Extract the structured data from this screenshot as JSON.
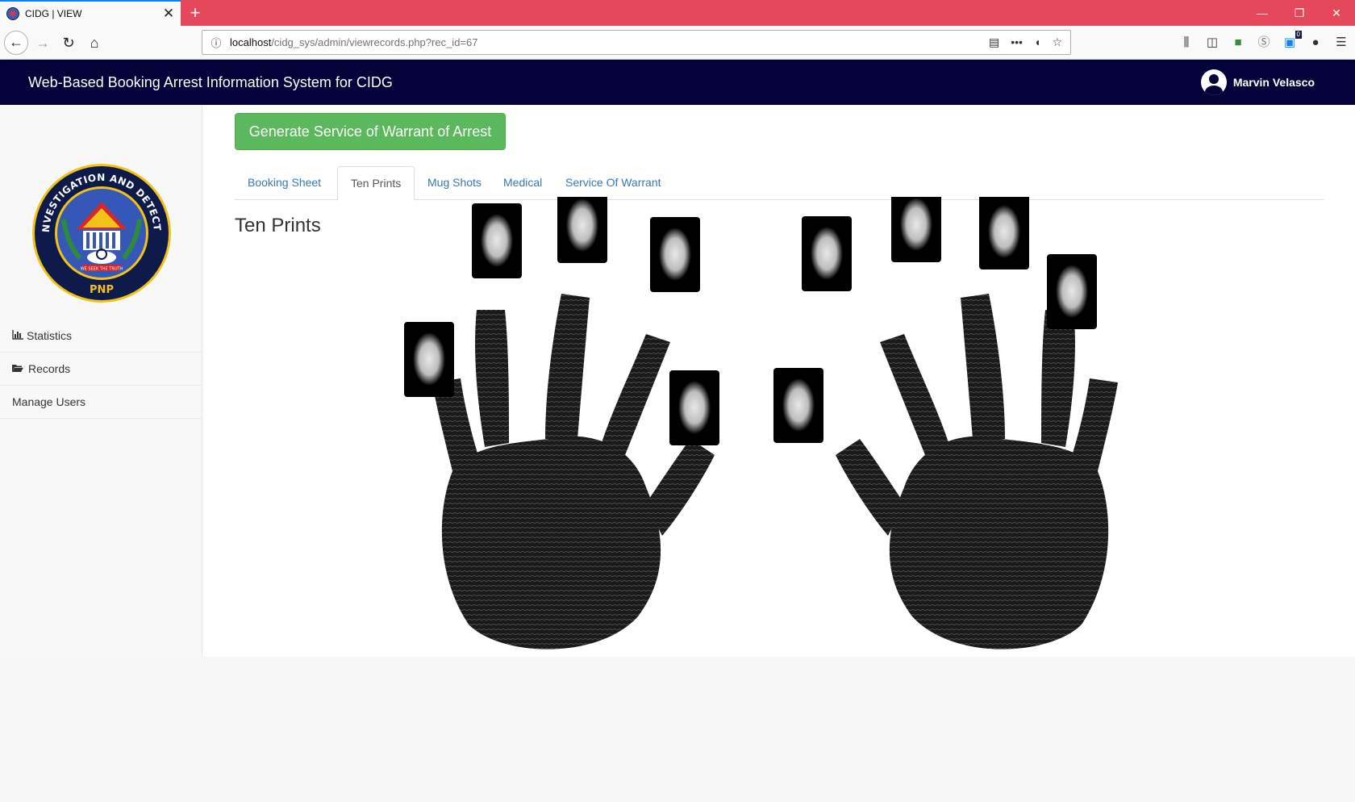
{
  "browser": {
    "tab_title": "CIDG | VIEW",
    "new_tab": "+",
    "url_host": "localhost",
    "url_path": "/cidg_sys/admin/viewrecords.php?rec_id=67",
    "badge_count": "0"
  },
  "header": {
    "title": "Web-Based Booking Arrest Information System for CIDG",
    "user_name": "Marvin Velasco"
  },
  "logo": {
    "top_text": "CRIMINAL INVESTIGATION AND DETECTION GROUP",
    "motto": "WE SEEK THE TRUTH",
    "bottom_text": "PNP"
  },
  "sidebar": {
    "items": [
      {
        "label": "Statistics",
        "icon": "bar-chart-icon"
      },
      {
        "label": "Records",
        "icon": "folder-open-icon"
      },
      {
        "label": "Manage Users",
        "icon": ""
      }
    ]
  },
  "main": {
    "generate_button": "Generate Service of Warrant of Arrest",
    "tabs": [
      {
        "label": "Booking Sheet"
      },
      {
        "label": "Ten Prints",
        "active": true
      },
      {
        "label": "Mug Shots"
      },
      {
        "label": "Medical"
      },
      {
        "label": "Service Of Warrant"
      }
    ],
    "section_title": "Ten Prints"
  },
  "colors": {
    "tab_bar": "#e5485a",
    "app_header": "#03033a",
    "generate_button": "#5cb85c",
    "link": "#337ab7"
  }
}
